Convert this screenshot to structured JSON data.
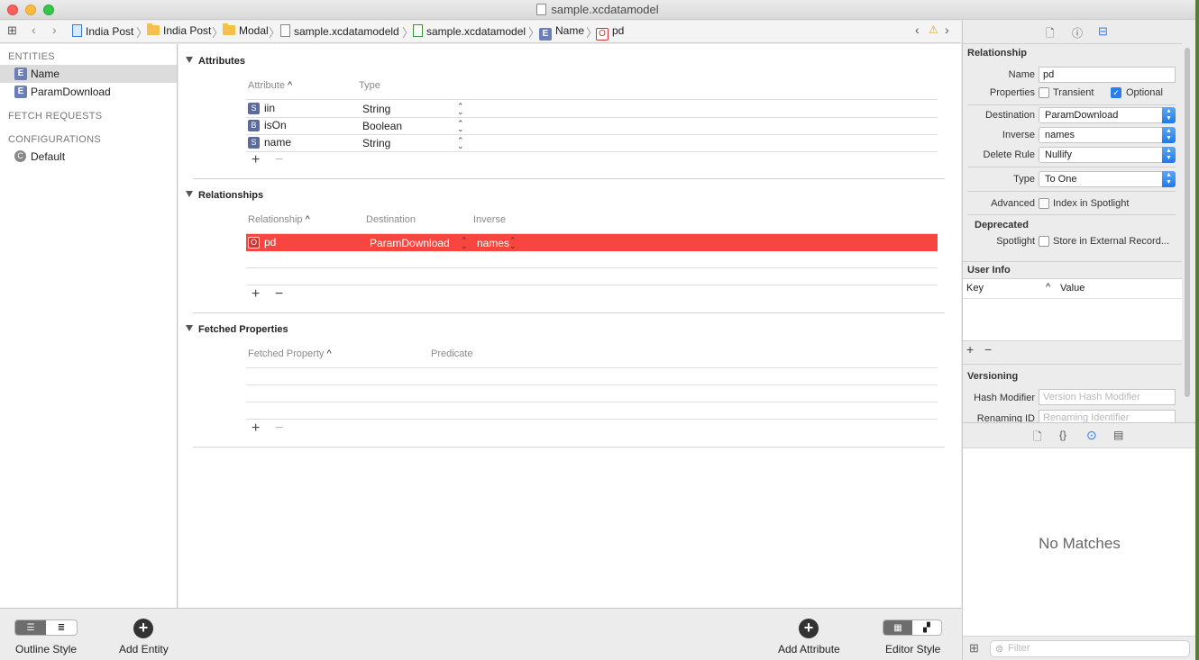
{
  "window": {
    "title": "sample.xcdatamodel",
    "traffic_lights": {
      "close": "#fc605c",
      "minimize": "#fdbc40",
      "zoom": "#34c84a"
    }
  },
  "jumpbar": {
    "crumbs": [
      {
        "label": "India Post",
        "icon": "project-icon"
      },
      {
        "label": "India Post",
        "icon": "folder-icon"
      },
      {
        "label": "Modal",
        "icon": "folder-icon"
      },
      {
        "label": "sample.xcdatamodeld",
        "icon": "datamodel-bundle-icon"
      },
      {
        "label": "sample.xcdatamodel",
        "icon": "datamodel-file-icon"
      },
      {
        "label": "Name",
        "icon": "entity-icon"
      },
      {
        "label": "pd",
        "icon": "relationship-icon"
      }
    ]
  },
  "sidebar": {
    "entities_header": "ENTITIES",
    "entities": [
      {
        "label": "Name",
        "badge": "E",
        "selected": true
      },
      {
        "label": "ParamDownload",
        "badge": "E",
        "selected": false
      }
    ],
    "fetch_requests_header": "FETCH REQUESTS",
    "configurations_header": "CONFIGURATIONS",
    "configurations": [
      {
        "label": "Default",
        "badge": "C"
      }
    ]
  },
  "attributes": {
    "header": "Attributes",
    "col_attribute": "Attribute",
    "col_type": "Type",
    "rows": [
      {
        "badge": "S",
        "name": "iin",
        "type": "String"
      },
      {
        "badge": "B",
        "name": "isOn",
        "type": "Boolean"
      },
      {
        "badge": "S",
        "name": "name",
        "type": "String"
      }
    ]
  },
  "relationships": {
    "header": "Relationships",
    "col_relationship": "Relationship",
    "col_destination": "Destination",
    "col_inverse": "Inverse",
    "rows": [
      {
        "badge": "O",
        "name": "pd",
        "destination": "ParamDownload",
        "inverse": "names",
        "selected": true
      }
    ],
    "selected_color": "#f9453f"
  },
  "fetched_properties": {
    "header": "Fetched Properties",
    "col_property": "Fetched Property",
    "col_predicate": "Predicate"
  },
  "bottombar": {
    "outline_style": "Outline Style",
    "add_entity": "Add Entity",
    "add_attribute": "Add Attribute",
    "editor_style": "Editor Style"
  },
  "inspector": {
    "section_title": "Relationship",
    "name_label": "Name",
    "name_value": "pd",
    "properties_label": "Properties",
    "transient_label": "Transient",
    "transient_checked": false,
    "optional_label": "Optional",
    "optional_checked": true,
    "destination_label": "Destination",
    "destination_value": "ParamDownload",
    "inverse_label": "Inverse",
    "inverse_value": "names",
    "delete_rule_label": "Delete Rule",
    "delete_rule_value": "Nullify",
    "type_label": "Type",
    "type_value": "To One",
    "advanced_label": "Advanced",
    "index_spotlight_label": "Index in Spotlight",
    "deprecated_label": "Deprecated",
    "spotlight_label": "Spotlight",
    "store_external_label": "Store in External Record...",
    "user_info_header": "User Info",
    "key_col": "Key",
    "value_col": "Value",
    "versioning_header": "Versioning",
    "hash_modifier_label": "Hash Modifier",
    "hash_modifier_placeholder": "Version Hash Modifier",
    "renaming_id_label": "Renaming ID",
    "renaming_id_placeholder": "Renaming Identifier",
    "no_matches": "No Matches",
    "filter_placeholder": "Filter",
    "accent": "#2b7de9"
  }
}
